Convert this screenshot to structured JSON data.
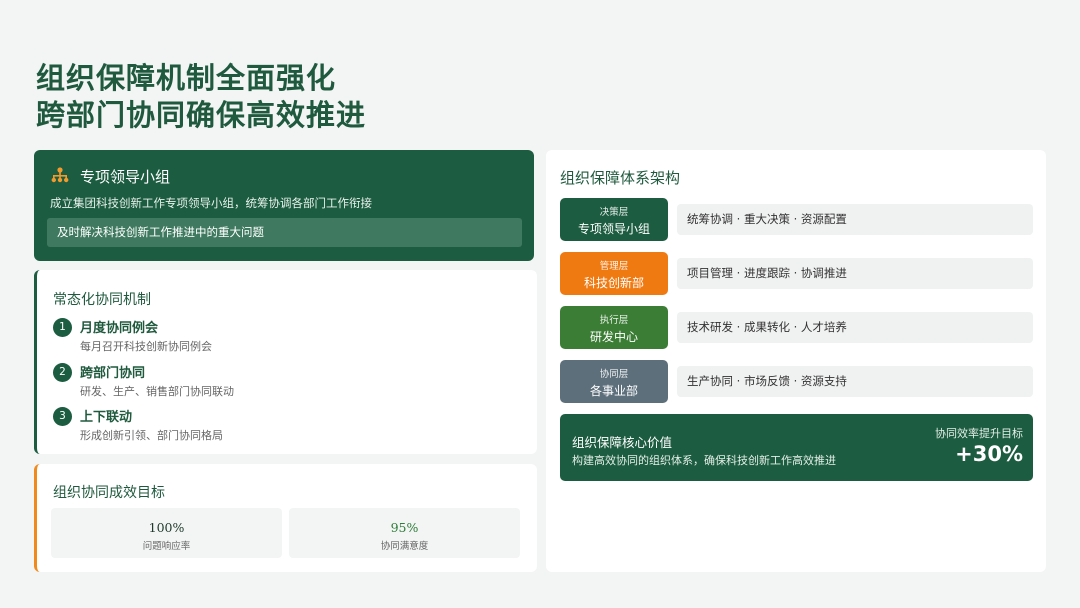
{
  "title": {
    "line1": "组织保障机制全面强化",
    "line2": "跨部门协同确保高效推进"
  },
  "leadership": {
    "icon": "org-chart-icon",
    "title": "专项领导小组",
    "description": "成立集团科技创新工作专项领导小组，统筹协调各部门工作衔接",
    "highlight": "及时解决科技创新工作推进中的重大问题"
  },
  "mechanism": {
    "title": "常态化协同机制",
    "items": [
      {
        "num": "1",
        "title": "月度协同例会",
        "desc": "每月召开科技创新协同例会"
      },
      {
        "num": "2",
        "title": "跨部门协同",
        "desc": "研发、生产、销售部门协同联动"
      },
      {
        "num": "3",
        "title": "上下联动",
        "desc": "形成创新引领、部门协同格局"
      }
    ]
  },
  "goals": {
    "title": "组织协同成效目标",
    "metrics": [
      {
        "value": "100%",
        "label": "问题响应率",
        "color": "#1f3a2d"
      },
      {
        "value": "95%",
        "label": "协同满意度",
        "color": "#2e7d3a"
      }
    ]
  },
  "architecture": {
    "title": "组织保障体系架构",
    "layers": [
      {
        "level": "决策层",
        "name": "专项领导小组",
        "duties": "统筹协调 · 重大决策 · 资源配置",
        "color": "#1c5c40"
      },
      {
        "level": "管理层",
        "name": "科技创新部",
        "duties": "项目管理 · 进度跟踪 · 协调推进",
        "color": "#f07a12"
      },
      {
        "level": "执行层",
        "name": "研发中心",
        "duties": "技术研发 · 成果转化 · 人才培养",
        "color": "#3b7d35"
      },
      {
        "level": "协同层",
        "name": "各事业部",
        "duties": "生产协同 · 市场反馈 · 资源支持",
        "color": "#5d6f7b"
      }
    ],
    "core": {
      "title": "组织保障核心价值",
      "desc": "构建高效协同的组织体系，确保科技创新工作高效推进",
      "goal_label": "协同效率提升目标",
      "goal_value": "+30%"
    }
  }
}
